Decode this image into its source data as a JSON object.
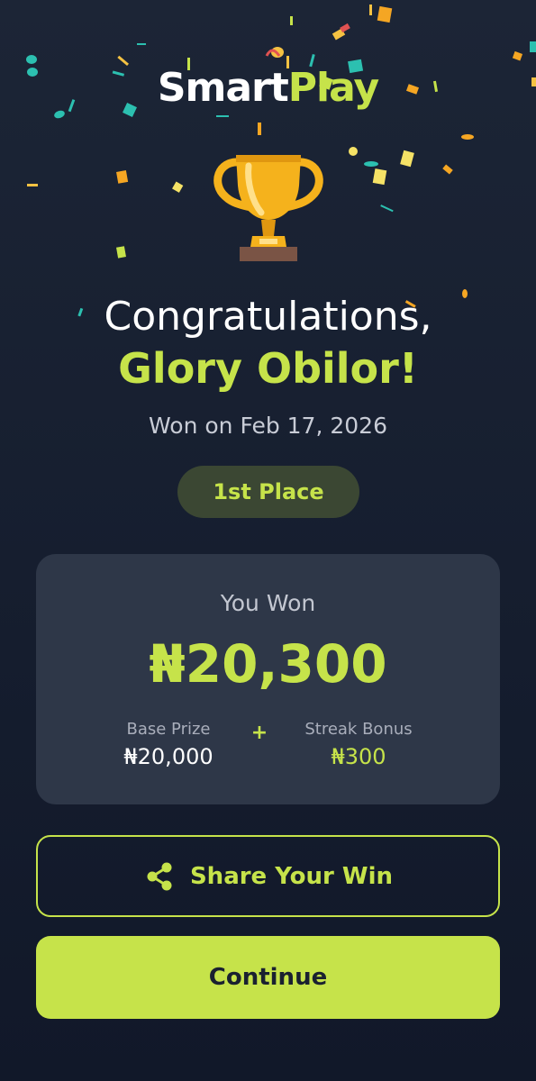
{
  "brand": {
    "name_primary": "Smart",
    "name_accent": "Play"
  },
  "trophy_icon": "trophy-icon",
  "headline": "Congratulations,",
  "winner_name": "Glory Obilor!",
  "won_date": "Won on Feb 17, 2026",
  "place_badge": "1st Place",
  "winnings": {
    "label": "You Won",
    "amount": "₦20,300",
    "base_label": "Base Prize",
    "base_value": "₦20,000",
    "plus_sign": "+",
    "streak_label": "Streak Bonus",
    "streak_value": "₦300"
  },
  "actions": {
    "share_label": "Share Your Win",
    "share_icon": "share-icon",
    "continue_label": "Continue"
  },
  "colors": {
    "accent": "#c6e34a",
    "background": "#1c2536",
    "card": "#2e3748",
    "badge": "#3b4733"
  }
}
